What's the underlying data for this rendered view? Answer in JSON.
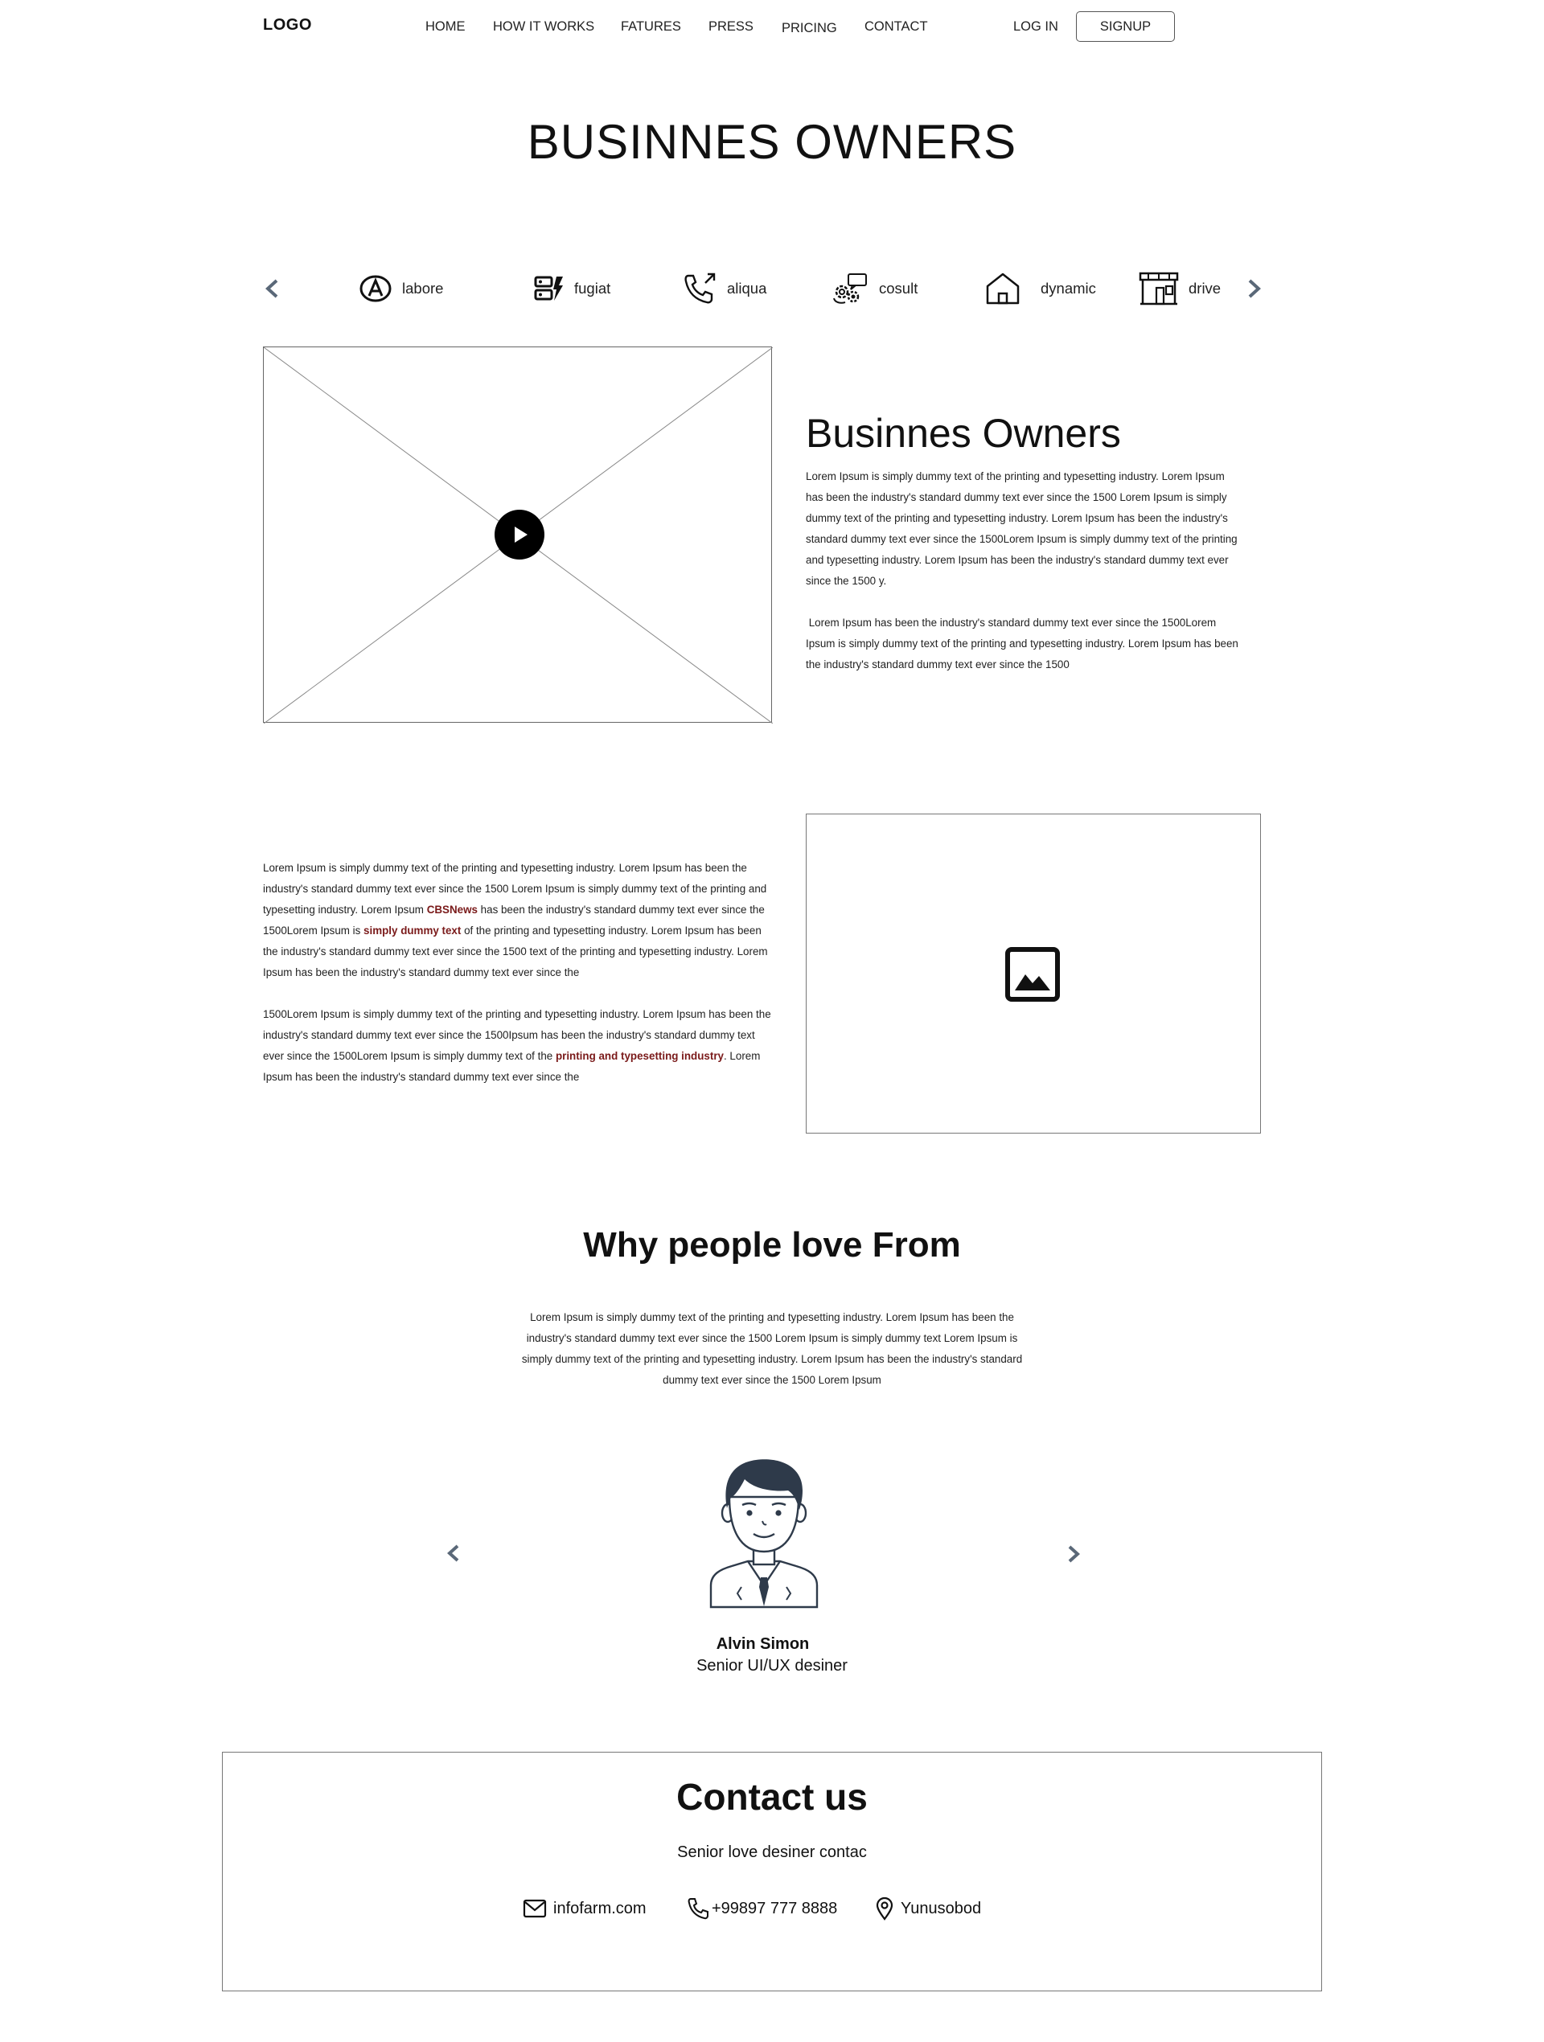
{
  "nav": {
    "logo": "LOGO",
    "links": [
      "HOME",
      "HOW IT WORKS",
      "FATURES",
      "PRESS",
      "PRICING",
      "CONTACT"
    ],
    "login": "LOG IN",
    "signup": "SIGNUP"
  },
  "hero": {
    "title": "BUSINNES OWNERS"
  },
  "categories": {
    "items": [
      {
        "label": "labore",
        "icon": "letter-a-circle-icon"
      },
      {
        "label": "fugiat",
        "icon": "server-bolt-icon"
      },
      {
        "label": "aliqua",
        "icon": "phone-outgoing-icon"
      },
      {
        "label": "cosult",
        "icon": "gears-chat-icon"
      },
      {
        "label": "dynamic",
        "icon": "house-icon"
      },
      {
        "label": "drive",
        "icon": "storefront-icon"
      }
    ]
  },
  "intro": {
    "title": "Businnes Owners",
    "p1": "Lorem Ipsum is simply dummy text of the printing and typesetting industry. Lorem Ipsum has been the industry's standard dummy text ever since the 1500 Lorem Ipsum is simply dummy text of the printing and typesetting industry. Lorem Ipsum has been the industry's standard dummy text ever since the 1500Lorem Ipsum is simply dummy text of the printing and typesetting industry. Lorem Ipsum has been the industry's standard dummy text ever since the 1500 y.",
    "p2": " Lorem Ipsum has been the industry's standard dummy text ever since the 1500Lorem Ipsum is simply dummy text of the printing and typesetting industry. Lorem Ipsum has been the industry's standard dummy text ever since the 1500"
  },
  "story": {
    "p1_a": "Lorem Ipsum is simply dummy text of the printing and typesetting industry. Lorem Ipsum has been the industry's standard dummy text ever since the 1500 Lorem Ipsum is simply dummy text of the printing and typesetting industry. Lorem Ipsum ",
    "p1_hl1": "CBSNews",
    "p1_b": " has been the industry's standard dummy text ever since the 1500Lorem Ipsum is ",
    "p1_hl2": "simply dummy text",
    "p1_c": " of the printing and typesetting industry. Lorem Ipsum has been the industry's standard dummy text ever since the 1500 text of the printing and typesetting industry. Lorem Ipsum has been the industry's standard dummy text ever since the",
    "p2_a": "1500Lorem Ipsum is simply dummy text of the printing and typesetting industry. Lorem Ipsum has been the industry's standard dummy text ever since the 1500Ipsum has been the industry's standard dummy text ever since the 1500Lorem Ipsum is simply dummy text of the ",
    "p2_hl": "printing and typesetting industry",
    "p2_b": ". Lorem Ipsum has been the industry's standard dummy text ever since the"
  },
  "testimonials": {
    "title": "Why people love From",
    "text": "Lorem Ipsum is simply dummy text of the printing and typesetting industry. Lorem Ipsum has been the industry's standard dummy text ever since the 1500 Lorem Ipsum is simply dummy text Lorem Ipsum is simply dummy text of the printing and typesetting industry. Lorem Ipsum has been the industry's standard dummy text ever since the 1500 Lorem Ipsum",
    "person": {
      "name": "Alvin Simon",
      "role": "Senior UI/UX desiner"
    }
  },
  "contact": {
    "title": "Contact us",
    "subtitle": "Senior love desiner contac",
    "email": "infofarm.com",
    "phone": "+99897 777 8888",
    "location": "Yunusobod"
  },
  "colors": {
    "accent_text": "#7a1a1a",
    "arrow": "#5a6878",
    "border": "#777777"
  }
}
